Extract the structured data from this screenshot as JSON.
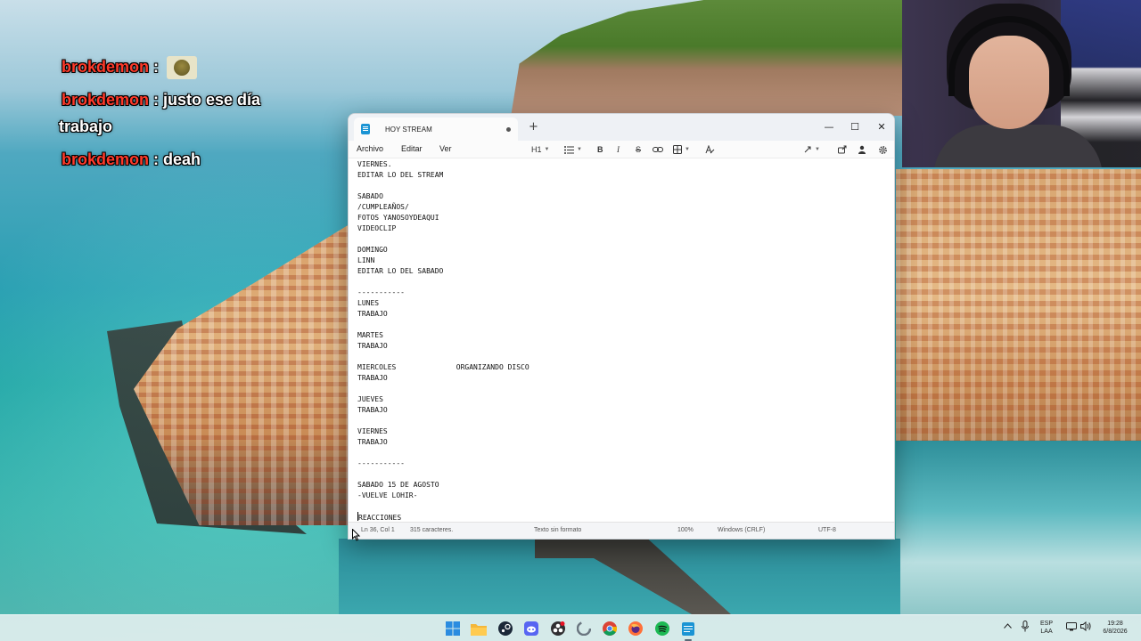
{
  "chat": {
    "messages": [
      {
        "user": "brokdemon",
        "sep": " : ",
        "text": ""
      },
      {
        "user": "brokdemon",
        "sep": " : ",
        "text": "justo ese día"
      },
      {
        "user": "",
        "sep": "",
        "text": "trabajo"
      },
      {
        "user": "brokdemon",
        "sep": " : ",
        "text": "deah"
      }
    ]
  },
  "window": {
    "tab_title": "HOY STREAM",
    "new_tab": "+",
    "minimize": "—",
    "maximize": "☐",
    "close": "✕"
  },
  "menu": {
    "file": "Archivo",
    "edit": "Editar",
    "view": "Ver"
  },
  "toolbar": {
    "heading": "H1",
    "bold": "B",
    "italic": "I",
    "strike": "S"
  },
  "editor": {
    "lines": [
      "VIERNES.",
      "EDITAR LO DEL STREAM",
      "",
      "SABADO",
      "/CUMPLEAÑOS/",
      "FOTOS YANOSOYDEAQUI",
      "VIDEOCLIP",
      "",
      "DOMINGO",
      "LINN",
      "EDITAR LO DEL SABADO",
      "",
      "-----------",
      "LUNES",
      "TRABAJO",
      "",
      "MARTES",
      "TRABAJO",
      "",
      "MIERCOLES              ORGANIZANDO DISCO",
      "TRABAJO",
      "",
      "JUEVES",
      "TRABAJO",
      "",
      "VIERNES",
      "TRABAJO",
      "",
      "-----------",
      "",
      "SABADO 15 DE AGOSTO",
      "-VUELVE LOHIR-",
      "",
      "REACCIONES"
    ]
  },
  "status": {
    "position": "Ln 36, Col 1",
    "chars": "315 caracteres.",
    "format": "Texto sin formato",
    "zoom": "100%",
    "line_ending": "Windows (CRLF)",
    "encoding": "UTF-8"
  },
  "taskbar": {
    "apps": [
      "windows-start-icon",
      "file-explorer-icon",
      "steam-icon",
      "discord-icon",
      "obs-icon",
      "edge-icon",
      "chrome-icon",
      "firefox-icon",
      "spotify-icon",
      "notepad-icon"
    ],
    "lang_top": "ESP",
    "lang_bottom": "LAA",
    "time": "19:28",
    "date": "6/8/2026"
  },
  "colors": {
    "chat_user": "#ff3a2a",
    "accent": "#1b94d4"
  }
}
